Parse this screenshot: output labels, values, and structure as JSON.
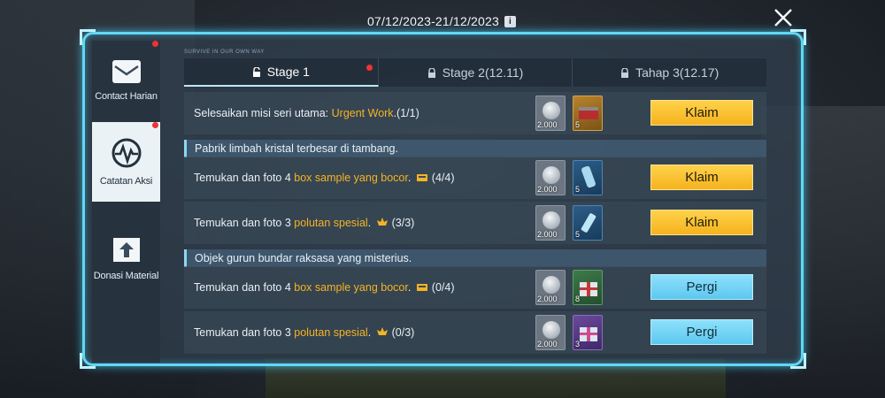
{
  "header": {
    "date_range": "07/12/2023-21/12/2023",
    "info_symbol": "i"
  },
  "sidebar": {
    "items": [
      {
        "label": "Contact Harian",
        "icon": "mail-icon",
        "has_notification": true,
        "active": false
      },
      {
        "label": "Catatan Aksi",
        "icon": "pulse-icon",
        "has_notification": true,
        "active": true
      },
      {
        "label": "Donasi Material",
        "icon": "donation-box-icon",
        "has_notification": false,
        "active": false
      }
    ]
  },
  "watermark": "SURVIVE IN OUR OWN WAY",
  "tabs": [
    {
      "label": "Stage 1",
      "active": true,
      "has_notification": true
    },
    {
      "label": "Stage 2(12.11)",
      "active": false,
      "has_notification": false
    },
    {
      "label": "Tahap 3(12.17)",
      "active": false,
      "has_notification": false
    }
  ],
  "main_mission": {
    "prefix": "Selesaikan misi seri utama: ",
    "highlight": "Urgent Work",
    "suffix": ".(1/1)",
    "rewards": {
      "coin": "2.000",
      "item_count": "5"
    },
    "button": "Klaim"
  },
  "sections": [
    {
      "title": "Pabrik limbah kristal terbesar di tambang.",
      "tasks": [
        {
          "prefix": "Temukan dan foto 4 ",
          "highlight": "box sample yang bocor",
          "suffix": ". ",
          "progress": "(4/4)",
          "coin": "2.000",
          "item_count": "5",
          "button": "Klaim"
        },
        {
          "prefix": "Temukan dan foto 3 ",
          "highlight": "polutan spesial",
          "suffix": ". ",
          "progress": "(3/3)",
          "coin": "2.000",
          "item_count": "5",
          "button": "Klaim"
        }
      ]
    },
    {
      "title": "Objek gurun bundar raksasa yang misterius.",
      "tasks": [
        {
          "prefix": "Temukan dan foto 4 ",
          "highlight": "box sample yang bocor",
          "suffix": ". ",
          "progress": "(0/4)",
          "coin": "2.000",
          "item_count": "8",
          "button": "Pergi"
        },
        {
          "prefix": "Temukan dan foto 3 ",
          "highlight": "polutan spesial",
          "suffix": ". ",
          "progress": "(0/3)",
          "coin": "2.000",
          "item_count": "3",
          "button": "Pergi"
        }
      ]
    }
  ],
  "colors": {
    "accent": "#5fd8f5",
    "highlight": "#f5b323",
    "claim": "#f5b21e",
    "go": "#5cc8ef"
  }
}
